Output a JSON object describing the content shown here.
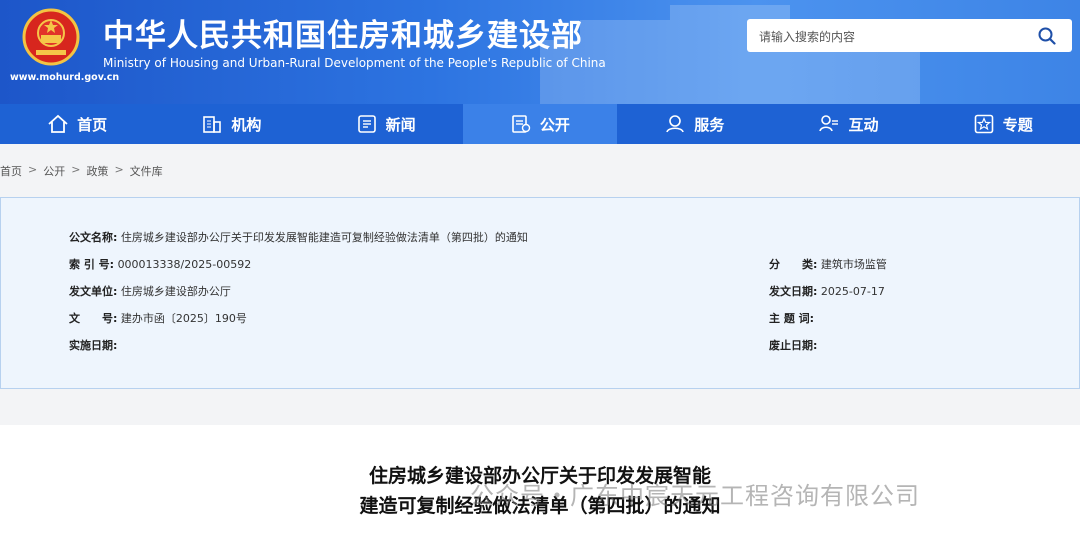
{
  "header": {
    "title_cn": "中华人民共和国住房和城乡建设部",
    "title_en": "Ministry of Housing and Urban-Rural Development of the People's Republic of China",
    "url": "www.mohurd.gov.cn",
    "search_placeholder": "请输入搜索的内容"
  },
  "nav": {
    "items": [
      {
        "label": "首页",
        "icon": "home-icon"
      },
      {
        "label": "机构",
        "icon": "building-icon"
      },
      {
        "label": "新闻",
        "icon": "news-icon"
      },
      {
        "label": "公开",
        "icon": "document-icon",
        "active": true
      },
      {
        "label": "服务",
        "icon": "service-icon"
      },
      {
        "label": "互动",
        "icon": "interaction-icon"
      },
      {
        "label": "专题",
        "icon": "star-icon"
      }
    ]
  },
  "breadcrumb": [
    "首页",
    "公开",
    "政策",
    "文件库"
  ],
  "meta": {
    "doc_name_label": "公文名称:",
    "doc_name": "住房城乡建设部办公厅关于印发发展智能建造可复制经验做法清单（第四批）的通知",
    "index_label": "索 引 号:",
    "index": "000013338/2025-00592",
    "category_label": "分　　类:",
    "category": "建筑市场监管",
    "issuer_label": "发文单位:",
    "issuer": "住房城乡建设部办公厅",
    "date_label": "发文日期:",
    "date": "2025-07-17",
    "docno_label": "文　　号:",
    "docno": "建办市函〔2025〕190号",
    "subject_label": "主 题 词:",
    "subject": "",
    "effective_label": "实施日期:",
    "effective": "",
    "abolish_label": "废止日期:",
    "abolish": ""
  },
  "article": {
    "title_line1": "住房城乡建设部办公厅关于印发发展智能",
    "title_line2": "建造可复制经验做法清单（第四批）的通知"
  },
  "watermark": "公众号・广东中宸天元工程咨询有限公司"
}
